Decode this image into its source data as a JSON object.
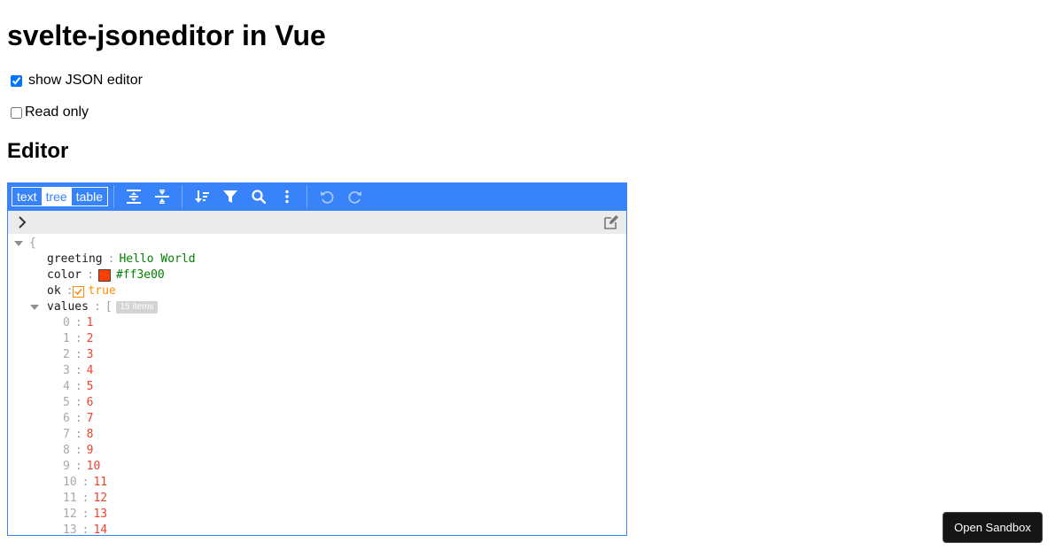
{
  "page": {
    "title": "svelte-jsoneditor in Vue",
    "show_editor_label": "show JSON editor",
    "show_editor_checked": true,
    "read_only_label": "Read only",
    "read_only_checked": false,
    "section_title": "Editor"
  },
  "editor": {
    "modes": [
      {
        "label": "text",
        "active": false
      },
      {
        "label": "tree",
        "active": true
      },
      {
        "label": "table",
        "active": false
      }
    ],
    "toolbar_icons": [
      "expand-all-icon",
      "collapse-all-icon",
      "sort-icon",
      "filter-icon",
      "search-icon",
      "more-icon",
      "undo-icon",
      "redo-icon"
    ],
    "root_open": "{",
    "fields": {
      "greeting": {
        "key": "greeting",
        "value": "Hello World"
      },
      "color": {
        "key": "color",
        "value": "#ff3e00"
      },
      "ok": {
        "key": "ok",
        "value": "true"
      },
      "values": {
        "key": "values",
        "open": "[",
        "count_tag": "15 items"
      }
    },
    "items": [
      {
        "index": "0",
        "value": "1"
      },
      {
        "index": "1",
        "value": "2"
      },
      {
        "index": "2",
        "value": "3"
      },
      {
        "index": "3",
        "value": "4"
      },
      {
        "index": "4",
        "value": "5"
      },
      {
        "index": "5",
        "value": "6"
      },
      {
        "index": "6",
        "value": "7"
      },
      {
        "index": "7",
        "value": "8"
      },
      {
        "index": "8",
        "value": "9"
      },
      {
        "index": "9",
        "value": "10"
      },
      {
        "index": "10",
        "value": "11"
      },
      {
        "index": "11",
        "value": "12"
      },
      {
        "index": "12",
        "value": "13"
      },
      {
        "index": "13",
        "value": "14"
      }
    ],
    "colors": {
      "accent": "#3883fa",
      "string": "#008000",
      "number": "#ee422e",
      "boolean": "#ff8c00",
      "swatch": "#ff3e00"
    }
  },
  "footer": {
    "open_sandbox": "Open Sandbox"
  }
}
